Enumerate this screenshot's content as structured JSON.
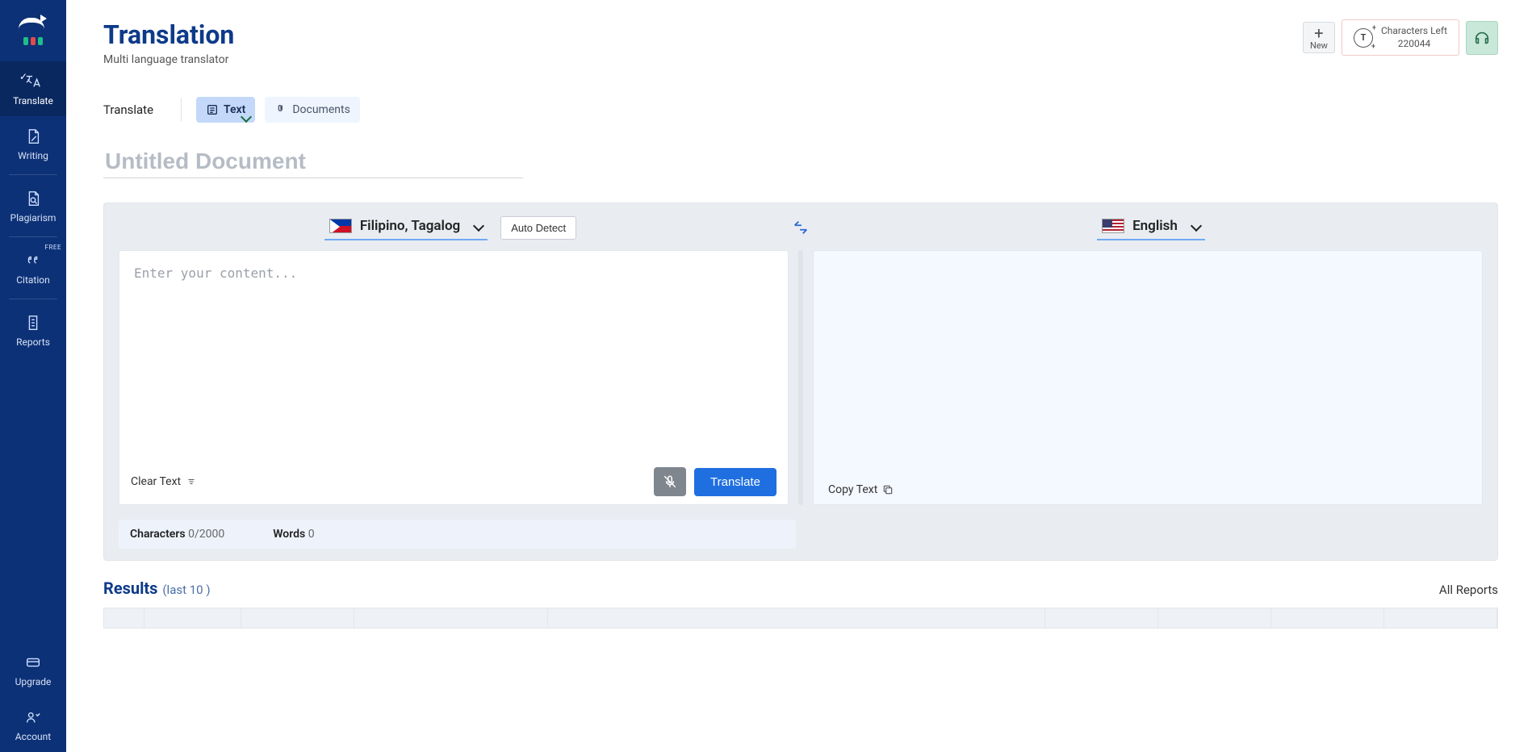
{
  "sidebar": {
    "items": [
      {
        "label": "Translate"
      },
      {
        "label": "Writing"
      },
      {
        "label": "Plagiarism"
      },
      {
        "label": "Citation",
        "badge": "FREE"
      },
      {
        "label": "Reports"
      }
    ],
    "bottom": [
      {
        "label": "Upgrade"
      },
      {
        "label": "Account"
      }
    ]
  },
  "header": {
    "title": "Translation",
    "subtitle": "Multi language translator",
    "new_label": "New",
    "chars_left_label": "Characters Left",
    "chars_left_value": "220044"
  },
  "tabs": {
    "section_label": "Translate",
    "text_tab": "Text",
    "documents_tab": "Documents"
  },
  "doc": {
    "title_placeholder": "Untitled Document"
  },
  "translator": {
    "source_lang": "Filipino, Tagalog",
    "target_lang": "English",
    "auto_detect": "Auto Detect",
    "input_placeholder": "Enter your content...",
    "clear_text": "Clear Text",
    "translate_btn": "Translate",
    "copy_text": "Copy Text",
    "characters_label": "Characters",
    "characters_value": "0/2000",
    "words_label": "Words",
    "words_value": "0"
  },
  "results": {
    "title": "Results",
    "subtitle": "(last 10 )",
    "all_reports": "All Reports"
  }
}
